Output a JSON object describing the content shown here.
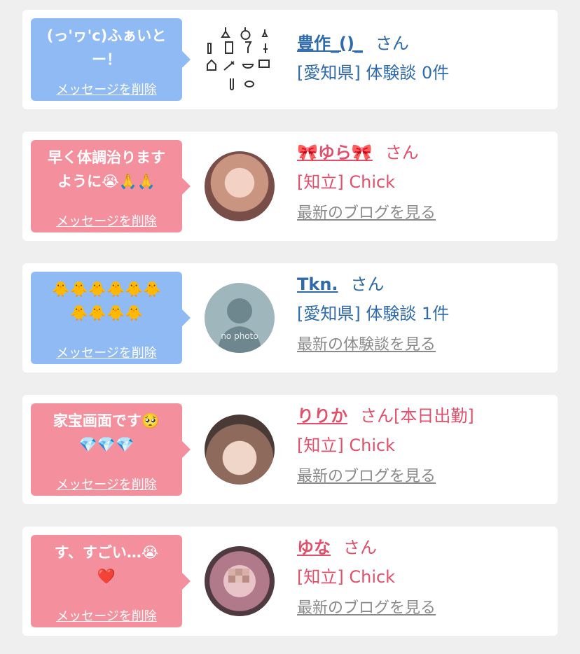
{
  "cards": [
    {
      "bubble_color": "#8fbaf3",
      "message": "(っ'ヮ'c)ふぁいと\nー！",
      "delete_label": "メッセージを削除",
      "avatar_icon": "chemistry-lab-icons",
      "name": "豊作_()_",
      "honorific": "さん",
      "detail": "[愛知県] 体験談 0件",
      "link": ""
    },
    {
      "bubble_color": "#f4909d",
      "message": "早く体調治ります\nように😭🙏🙏",
      "delete_label": "メッセージを削除",
      "avatar_icon": "photo-avatar",
      "name": "🎀ゆら🎀",
      "honorific": "さん",
      "detail": "[知立] Chick",
      "link": "最新のブログを見る"
    },
    {
      "bubble_color": "#8fbaf3",
      "message": "🐥🐥🐥🐥🐥🐥\n🐥🐥🐥🐥",
      "delete_label": "メッセージを削除",
      "avatar_icon": "no-photo-silhouette",
      "avatar_text": "no photo",
      "name": "Tkn.",
      "honorific": "さん",
      "detail": "[愛知県] 体験談 1件",
      "link": "最新の体験談を見る"
    },
    {
      "bubble_color": "#f4909d",
      "message": "家宝画面です🥺\n💎💎💎",
      "delete_label": "メッセージを削除",
      "avatar_icon": "photo-avatar",
      "name": "りりか",
      "honorific": "さん[本日出勤]",
      "detail": "[知立] Chick",
      "link": "最新のブログを見る"
    },
    {
      "bubble_color": "#f4909d",
      "message": "す、すごい…😭\n❤️",
      "delete_label": "メッセージを削除",
      "avatar_icon": "photo-avatar-mosaic",
      "name": "ゆな",
      "honorific": "さん",
      "detail": "[知立] Chick",
      "link": "最新のブログを見る"
    }
  ]
}
